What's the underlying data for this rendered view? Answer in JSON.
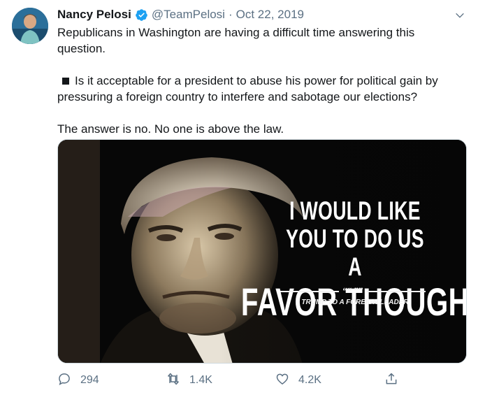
{
  "tweet": {
    "author_name": "Nancy Pelosi",
    "handle": "@TeamPelosi",
    "separator": "·",
    "date": "Oct 22, 2019",
    "verified": true,
    "text_line1": "Republicans in Washington are having a difficult time answering this question.",
    "text_line2": "Is it acceptable for a president to abuse his power for political gain by pressuring a foreign country to interfere and sabotage our elections?",
    "text_line3": "The answer is no. No one is above the law."
  },
  "media": {
    "quote_line1": "I WOULD LIKE",
    "quote_line2": "YOU TO DO US A",
    "quote_line3": "FAVOR THOUGH",
    "quote_marks": "““ ””",
    "attribution": "TRUMP TO A FOREIGN LEADER"
  },
  "actions": {
    "replies": "294",
    "retweets": "1.4K",
    "likes": "4.2K"
  },
  "icons": {
    "verified": "verified-badge-icon",
    "more": "chevron-down-icon",
    "reply": "reply-icon",
    "retweet": "retweet-icon",
    "like": "heart-icon",
    "share": "share-icon"
  },
  "colors": {
    "accent": "#1da1f2",
    "muted": "#5b7083",
    "text": "#14171a"
  }
}
